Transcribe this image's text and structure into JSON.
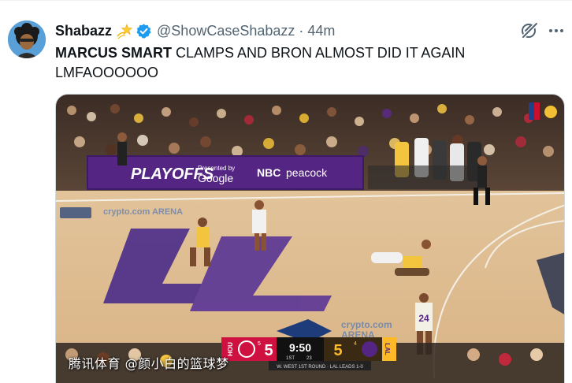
{
  "tweet": {
    "display_name": "Shabazz",
    "handle": "@ShowCaseShabazz",
    "separator": "·",
    "time": "44m",
    "text_bold": "MARCUS SMART",
    "text_rest": " CLAMPS AND BRON ALMOST DID IT AGAIN LMFAOOOOOO",
    "icons": {
      "badge": "dizzy-star-icon",
      "verified": "verified-badge-icon",
      "grok": "grok-icon",
      "more": "more-icon"
    },
    "colors": {
      "verified": "#1d9bf0",
      "secondary_text": "#536471"
    }
  },
  "video": {
    "banner_playoffs": "PLAYOFFS",
    "banner_presented": "Presented by",
    "banner_google": "Google",
    "banner_nbc": "NBC",
    "banner_peacock": "peacock",
    "arena_sign": "crypto.com ARENA",
    "arena_center_top": "crypto.com",
    "arena_center_bottom": "ARENA",
    "jersey_number": "24",
    "scoreboard": {
      "home_abbr": "HOU",
      "home_score": "5",
      "home_seed": "5",
      "clock": "9:50",
      "quarter": "1ST",
      "shot_clock": "23",
      "away_score": "5",
      "away_seed": "4",
      "away_abbr": "LAL",
      "series": "W. WEST 1ST ROUND · LAL LEADS 1-0"
    }
  },
  "watermark": "腾讯体育 @颜小白的篮球梦"
}
